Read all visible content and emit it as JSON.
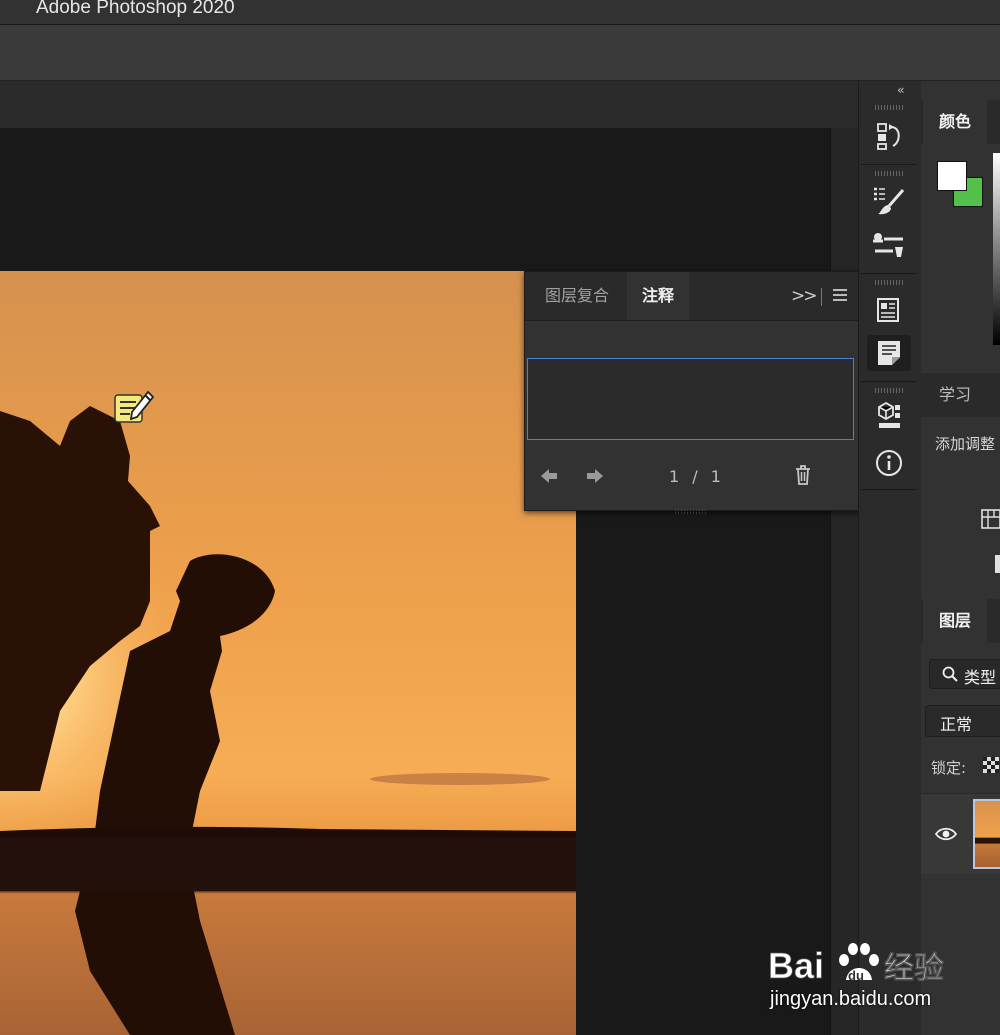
{
  "app": {
    "title": "Adobe Photoshop 2020"
  },
  "notes_panel": {
    "tabs": [
      {
        "label": "图层复合",
        "active": false
      },
      {
        "label": "注释",
        "active": true
      }
    ],
    "collapse_icon": "double-chevron-right-icon",
    "menu_icon": "panel-menu-icon",
    "note_text": "",
    "counter": "1 / 1",
    "footer_icons": [
      "arrow-left-icon",
      "arrow-right-icon",
      "trash-icon"
    ]
  },
  "dock": {
    "collapse_label": "‹‹",
    "icons": [
      "history-icon",
      "brush-preset-icon",
      "tool-presets-icon",
      "properties-icon",
      "notes-icon",
      "3d-icon",
      "info-icon"
    ],
    "active": "notes-icon"
  },
  "color_panel": {
    "tab_label": "颜色",
    "foreground": "#ffffff",
    "background": "#53c04c"
  },
  "learn_panel": {
    "tab_label": "学习",
    "subtitle": "添加调整"
  },
  "layers_panel": {
    "tab_label": "图层",
    "filter_label": "类型",
    "blend_mode": "正常",
    "lock_label": "锁定:"
  },
  "canvas": {
    "image": "sunset silhouette couple at beach"
  },
  "watermark": {
    "logo_text": "Baidu经验",
    "url": "jingyan.baidu.com"
  },
  "colors": {
    "accent_focus": "#4a7fd6",
    "ui_dark": "#2b2b2b",
    "ui_mid": "#323232"
  }
}
